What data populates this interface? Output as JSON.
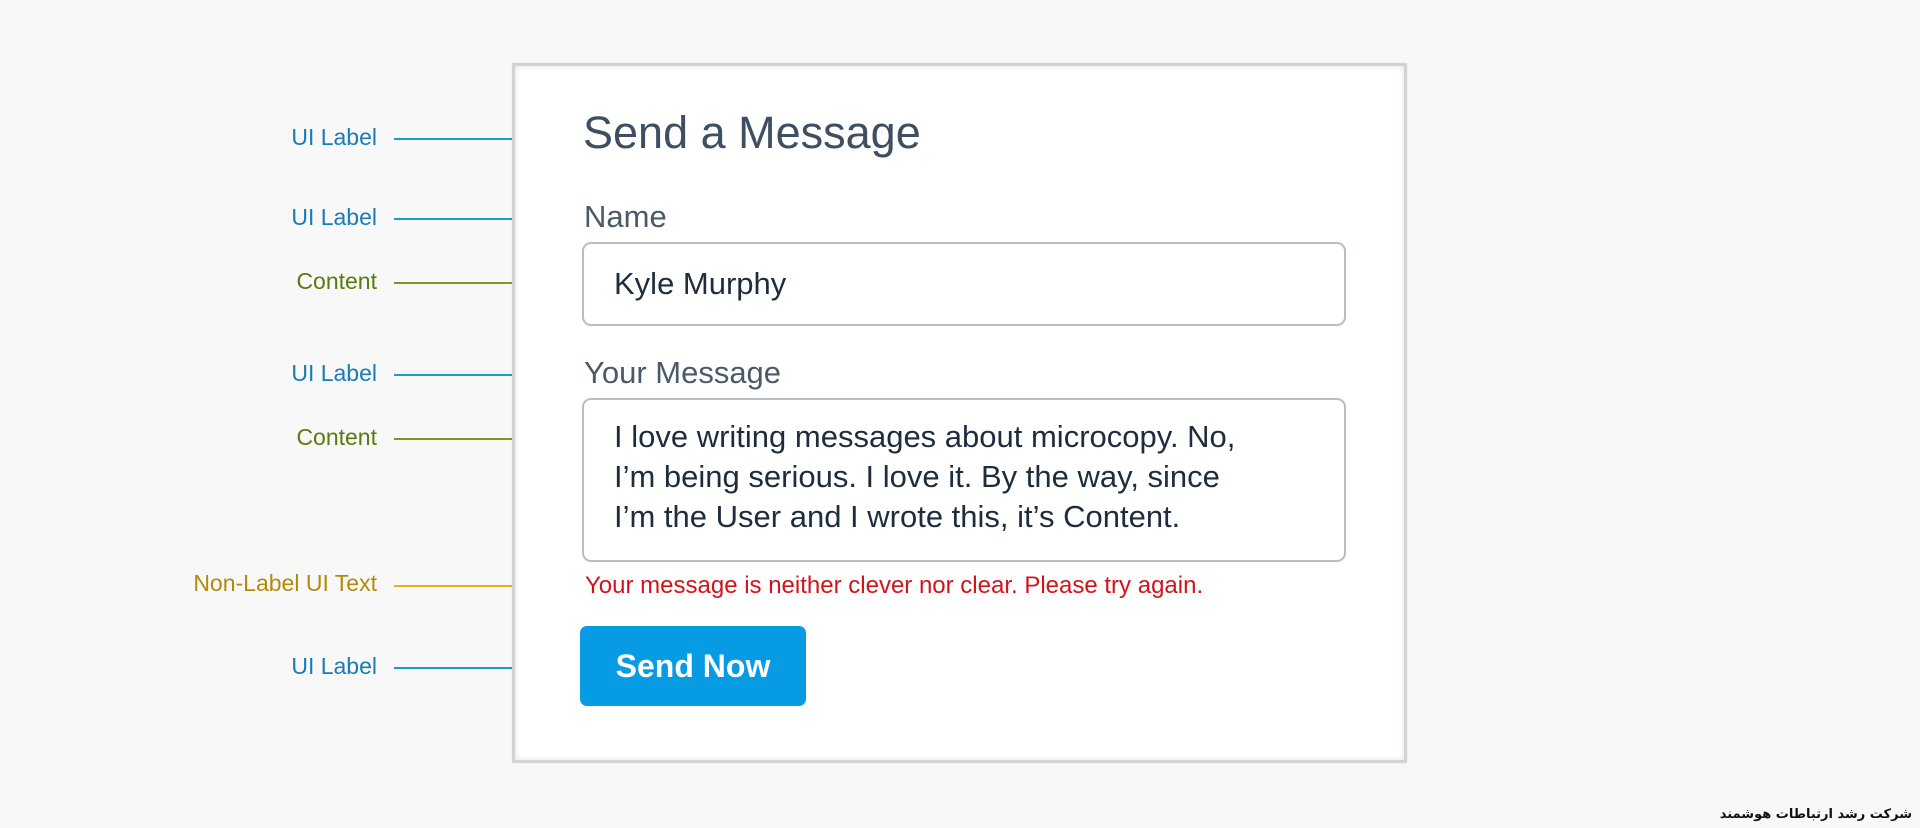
{
  "annotations": {
    "title_label": "UI Label",
    "name_label": "UI Label",
    "name_content": "Content",
    "message_label": "UI Label",
    "message_content": "Content",
    "error_text": "Non-Label UI Text",
    "button_label": "UI Label"
  },
  "colors": {
    "ui_label": "#1a7bb6",
    "content": "#5c7a0f",
    "non_label_ui_text": "#b38b0a",
    "error": "#d1141c",
    "button": "#079be3"
  },
  "form": {
    "title": "Send a Message",
    "name_label": "Name",
    "name_value": "Kyle Murphy",
    "message_label": "Your Message",
    "message_value": "I love writing messages about microcopy. No,\nI’m being serious. I love it. By the way, since\nI’m the User and I wrote this, it’s Content.",
    "error_message": "Your message is neither clever nor clear. Please try again.",
    "send_button": "Send Now"
  },
  "watermark": "شرکت رشد ارتباطات هوشمند"
}
